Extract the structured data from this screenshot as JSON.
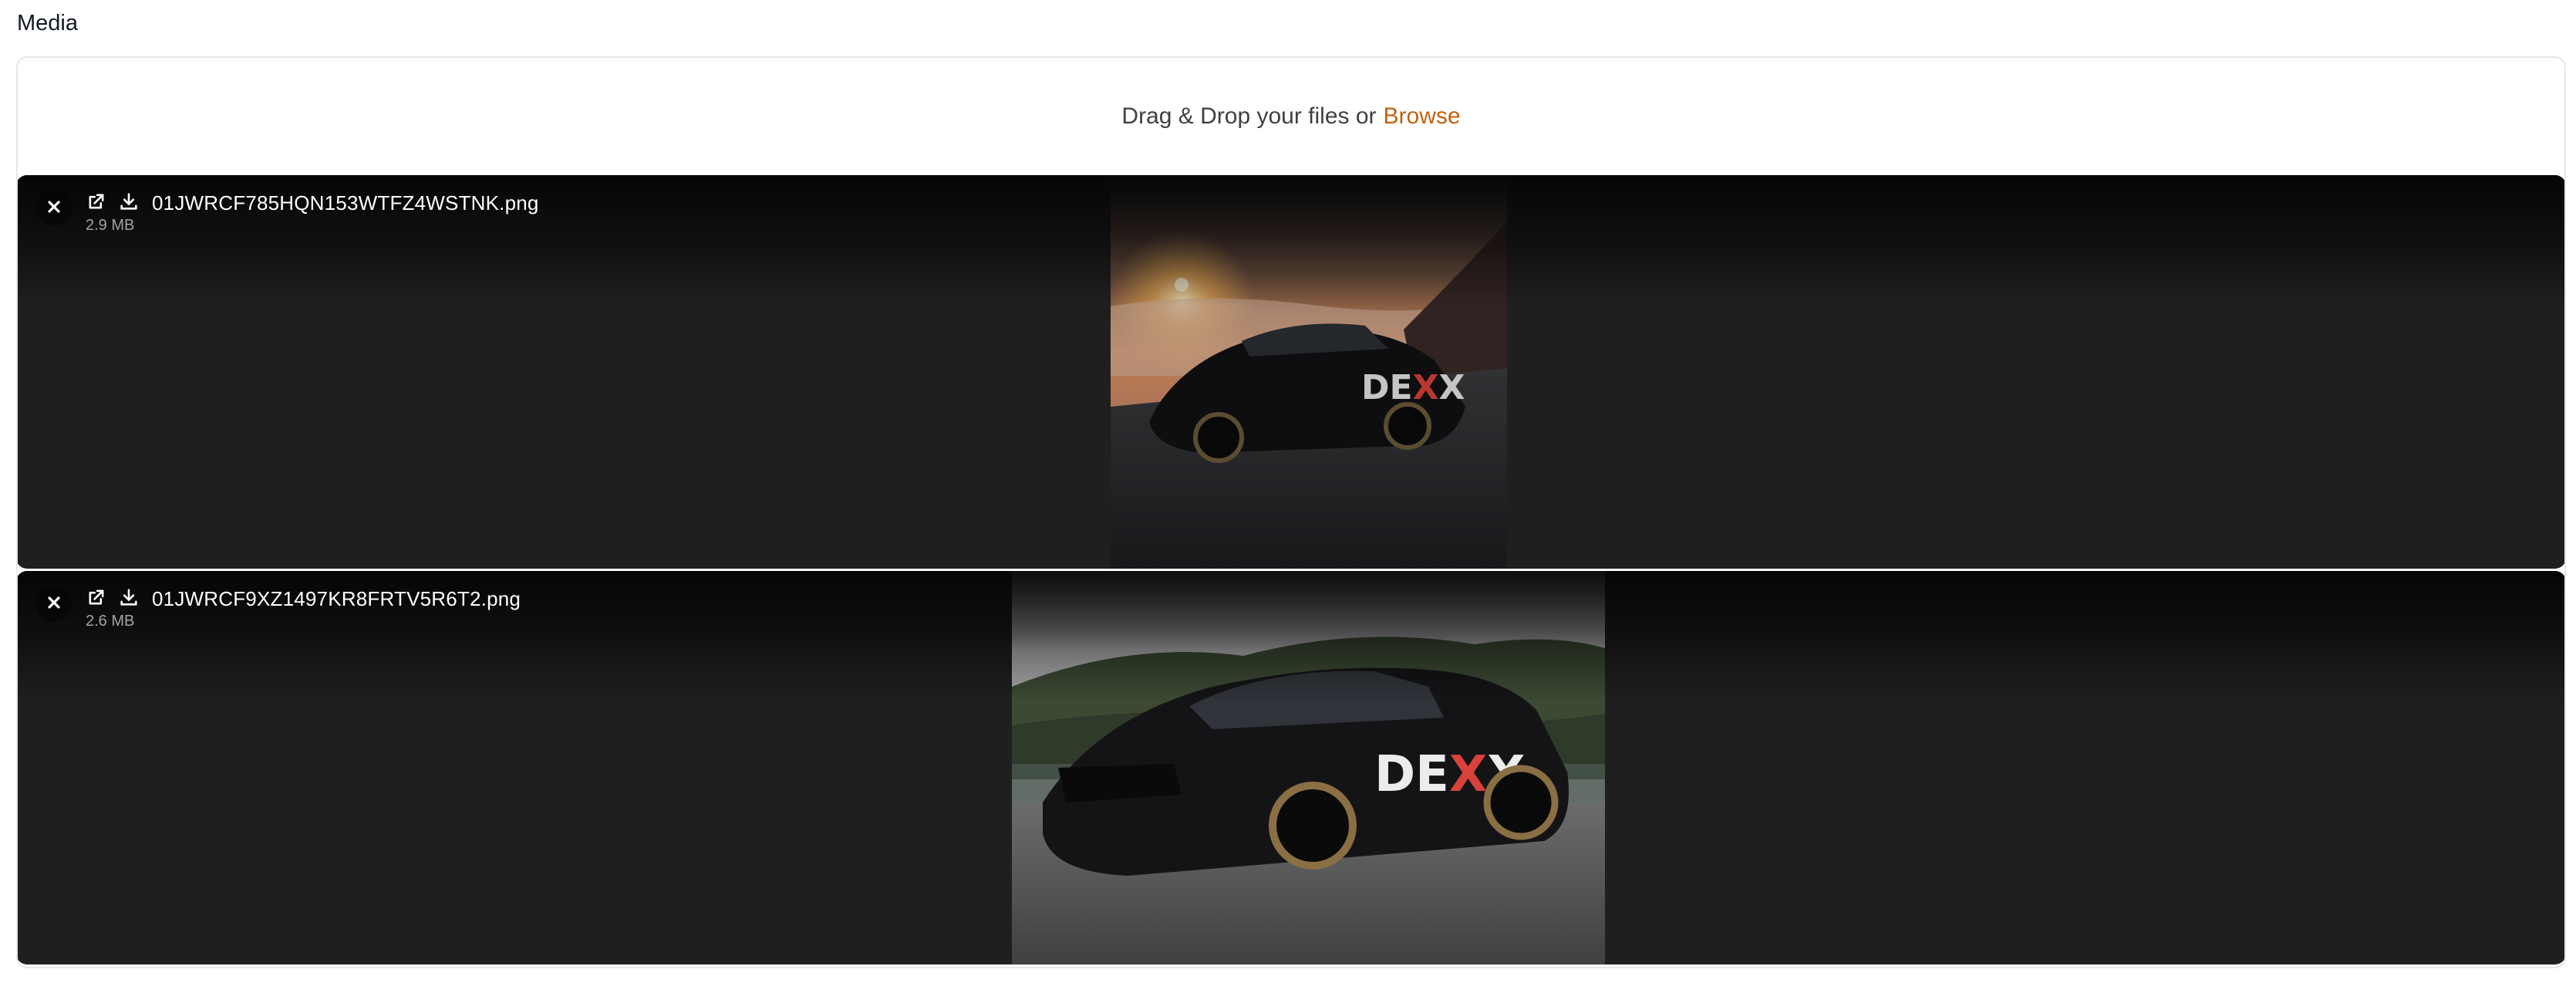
{
  "field": {
    "label": "Media"
  },
  "uploader": {
    "drop_text": "Drag & Drop your files or",
    "browse_label": "Browse"
  },
  "files": [
    {
      "name": "01JWRCF785HQN153WTFZ4WSTNK.png",
      "size": "2.9 MB",
      "remove_icon": "close-icon",
      "open_icon": "external-link-icon",
      "download_icon": "download-icon",
      "preview_text": "DEXX"
    },
    {
      "name": "01JWRCF9XZ1497KR8FRTV5R6T2.png",
      "size": "2.6 MB",
      "remove_icon": "close-icon",
      "open_icon": "external-link-icon",
      "download_icon": "download-icon",
      "preview_text": "DEXX"
    }
  ],
  "colors": {
    "accent": "#c2620f",
    "item_background": "#1f1f1f",
    "border": "#e5e7eb"
  }
}
